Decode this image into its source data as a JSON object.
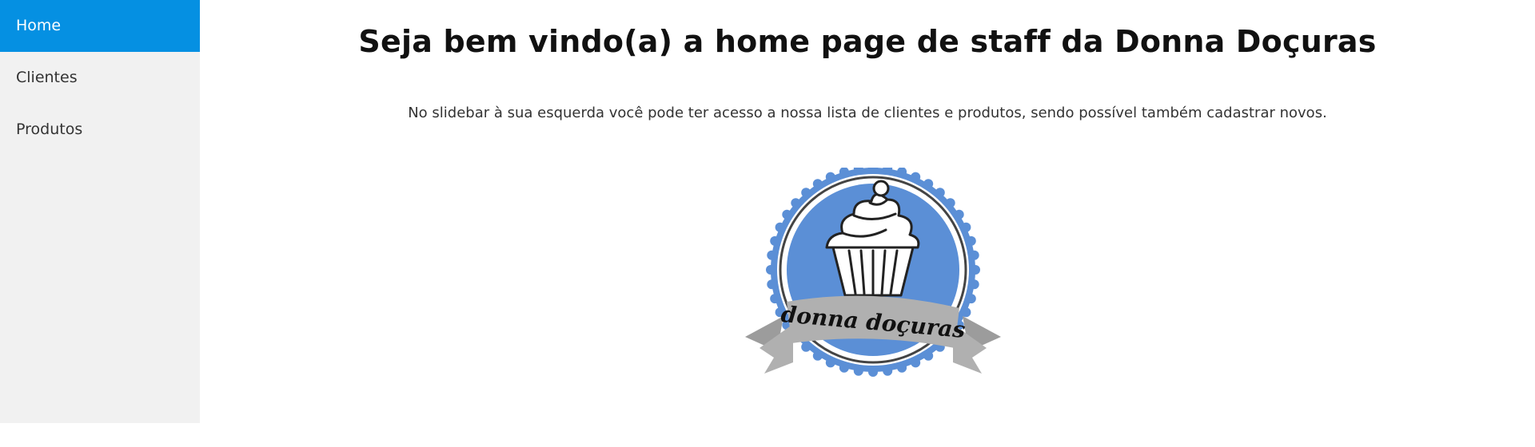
{
  "sidebar": {
    "items": [
      {
        "label": "Home",
        "active": true
      },
      {
        "label": "Clientes",
        "active": false
      },
      {
        "label": "Produtos",
        "active": false
      }
    ],
    "active_color": "#0590e2",
    "background": "#f1f1f1"
  },
  "main": {
    "title": "Seja bem vindo(a) a home page de staff da Donna Doçuras",
    "intro": "No slidebar à sua esquerda você pode ter acesso a nossa lista de clientes e produtos, sendo possível também cadastrar novos.",
    "logo": {
      "text": "donna doçuras",
      "icon": "cupcake-icon",
      "badge_color": "#5b8fd6",
      "ribbon_color": "#b0b0b0"
    }
  }
}
